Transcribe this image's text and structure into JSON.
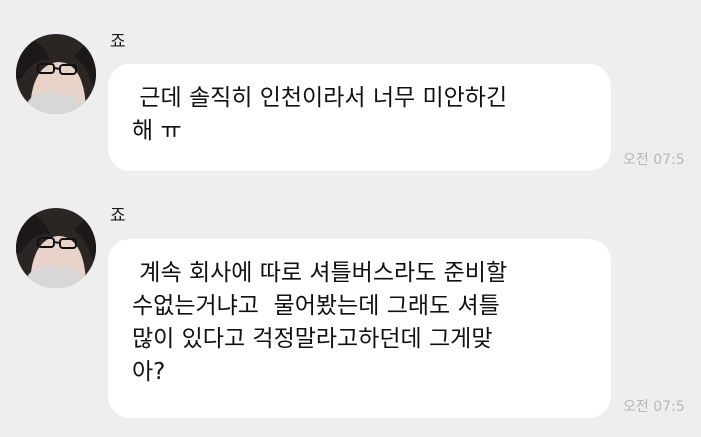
{
  "messages": [
    {
      "sender": "죠",
      "lines": [
        " 근데 솔직히 인천이라서 너무 미안하긴",
        "해 ㅠ"
      ],
      "time": "오전 07:5"
    },
    {
      "sender": "죠",
      "lines": [
        " 계속 회사에 따로 셔틀버스라도 준비할",
        "수없는거냐고  물어봤는데 그래도 셔틀",
        "많이 있다고 걱정말라고하던데 그게맞",
        "아?"
      ],
      "time": "오전 07:5"
    }
  ],
  "icons": {
    "avatar": "profile-photo-avatar"
  }
}
